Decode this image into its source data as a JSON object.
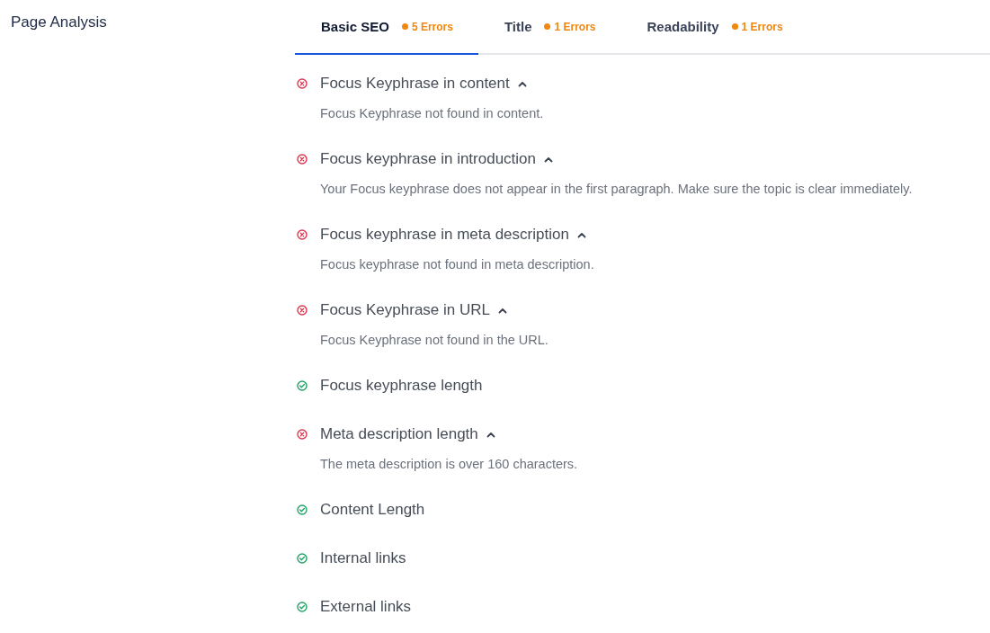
{
  "section": {
    "title": "Page Analysis"
  },
  "tabs": [
    {
      "label": "Basic SEO",
      "errors": "5 Errors",
      "selected": true
    },
    {
      "label": "Title",
      "errors": "1 Errors",
      "selected": false
    },
    {
      "label": "Readability",
      "errors": "1 Errors",
      "selected": false
    }
  ],
  "checks": [
    {
      "title": "Focus Keyphrase in content",
      "passed": false,
      "expanded": true,
      "description": "Focus Keyphrase not found in content."
    },
    {
      "title": "Focus keyphrase in introduction",
      "passed": false,
      "expanded": true,
      "description": "Your Focus keyphrase does not appear in the first paragraph. Make sure the topic is clear immediately."
    },
    {
      "title": "Focus keyphrase in meta description",
      "passed": false,
      "expanded": true,
      "description": "Focus keyphrase not found in meta description."
    },
    {
      "title": "Focus Keyphrase in URL",
      "passed": false,
      "expanded": true,
      "description": "Focus Keyphrase not found in the URL."
    },
    {
      "title": "Focus keyphrase length",
      "passed": true
    },
    {
      "title": "Meta description length",
      "passed": false,
      "expanded": true,
      "description": "The meta description is over 160 characters."
    },
    {
      "title": "Content Length",
      "passed": true
    },
    {
      "title": "Internal links",
      "passed": true
    },
    {
      "title": "External links",
      "passed": true
    }
  ]
}
